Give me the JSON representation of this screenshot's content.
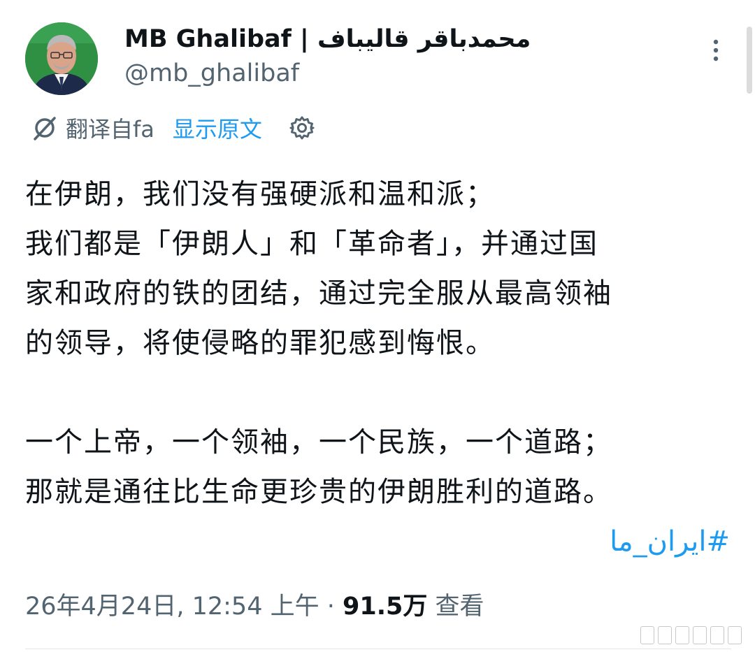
{
  "author": {
    "display_name": "MB Ghalibaf | محمدباقر قالیباف",
    "handle": "@mb_ghalibaf",
    "avatar_icon": "profile-photo"
  },
  "translation_bar": {
    "translated_from": "翻译自fa",
    "show_original": "显示原文",
    "icon": "translate-icon",
    "settings_icon": "gear-icon"
  },
  "tweet": {
    "lines": [
      "在伊朗，我们没有强硬派和温和派；",
      "我们都是「伊朗人」和「革命者」，并通过国",
      "家和政府的铁的团结，通过完全服从最高领袖",
      "的领导，将使侵略的罪犯感到悔恨。",
      "",
      "一个上帝，一个领袖，一个民族，一个道路；",
      "那就是通往比生命更珍贵的伊朗胜利的道路。"
    ],
    "hashtag": "#ایران_ما"
  },
  "meta": {
    "timestamp": "26年4月24日, 12:54 上午",
    "separator": " · ",
    "views_count": "91.5万",
    "views_label": " 查看"
  },
  "colors": {
    "text": "#0f1419",
    "secondary": "#536471",
    "link": "#1d9bf0"
  }
}
